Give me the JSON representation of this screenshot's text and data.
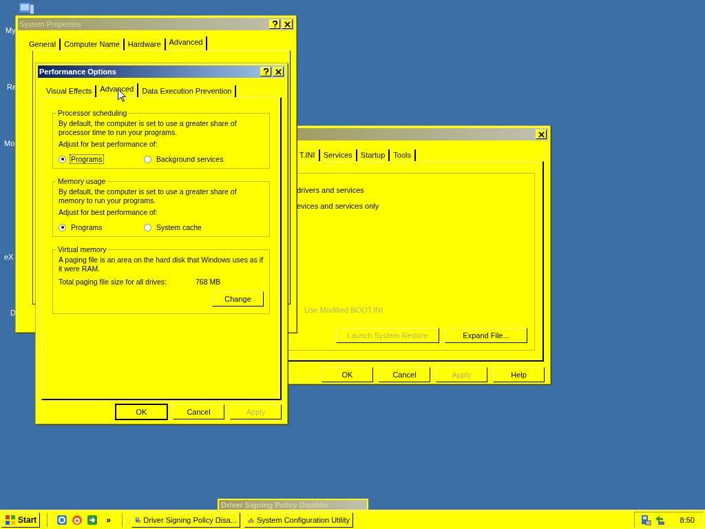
{
  "desktop_icons": [
    {
      "label": "My"
    },
    {
      "label": "Re"
    },
    {
      "label": "Mo"
    },
    {
      "label": "eX"
    },
    {
      "label": "D"
    }
  ],
  "system_properties": {
    "title": "System Properties",
    "active": false,
    "tabs": [
      {
        "label": "General",
        "selected": false
      },
      {
        "label": "Computer Name",
        "selected": false
      },
      {
        "label": "Hardware",
        "selected": false
      },
      {
        "label": "Advanced",
        "selected": true
      }
    ]
  },
  "system_configuration": {
    "active": false,
    "tabs": [
      {
        "label": "T.INI",
        "selected": false
      },
      {
        "label": "Services",
        "selected": false
      },
      {
        "label": "Startup",
        "selected": false
      },
      {
        "label": "Tools",
        "selected": false
      }
    ],
    "lines": [
      "drivers and services",
      "evices and services only"
    ],
    "boot_option": {
      "label": "Use Modified BOOT.INI",
      "disabled": true
    },
    "buttons": [
      {
        "label": "Launch System Restore",
        "disabled": true
      },
      {
        "label": "Expand File...",
        "disabled": false
      }
    ],
    "dialog_buttons": [
      {
        "label": "OK",
        "disabled": false
      },
      {
        "label": "Cancel",
        "disabled": false
      },
      {
        "label": "Apply",
        "disabled": true
      },
      {
        "label": "Help",
        "disabled": false
      }
    ]
  },
  "performance_options": {
    "title": "Performance Options",
    "active": true,
    "tabs": [
      {
        "label": "Visual Effects",
        "selected": false
      },
      {
        "label": "Advanced",
        "selected": true
      },
      {
        "label": "Data Execution Prevention",
        "selected": false
      }
    ],
    "processor_scheduling": {
      "title": "Processor scheduling",
      "description": "By default, the computer is set to use a greater share of processor time to run your programs.",
      "adjust_label": "Adjust for best performance of:",
      "options": [
        {
          "label": "Programs",
          "selected": true,
          "focused": true
        },
        {
          "label": "Background services",
          "selected": false,
          "focused": false
        }
      ]
    },
    "memory_usage": {
      "title": "Memory usage",
      "description": "By default, the computer is set to use a greater share of memory to run your programs.",
      "adjust_label": "Adjust for best performance of:",
      "options": [
        {
          "label": "Programs",
          "selected": true,
          "focused": false
        },
        {
          "label": "System cache",
          "selected": false,
          "focused": false
        }
      ]
    },
    "virtual_memory": {
      "title": "Virtual memory",
      "description": "A paging file is an area on the hard disk that Windows uses as if it were RAM.",
      "total_label": "Total paging file size for all drives:",
      "total_value": "768 MB",
      "button": "Change"
    },
    "buttons": [
      {
        "label": "OK",
        "disabled": false,
        "default": true
      },
      {
        "label": "Cancel",
        "disabled": false,
        "default": false
      },
      {
        "label": "Apply",
        "disabled": true,
        "default": false
      }
    ]
  },
  "background_window": {
    "title": "Driver Signing Policy Disabler",
    "active": false
  },
  "taskbar": {
    "start": "Start",
    "more": "»",
    "tasks": [
      {
        "label": "Driver Signing Policy Disa..."
      },
      {
        "label": "System Configuration Utility"
      }
    ],
    "clock": "8:50"
  }
}
